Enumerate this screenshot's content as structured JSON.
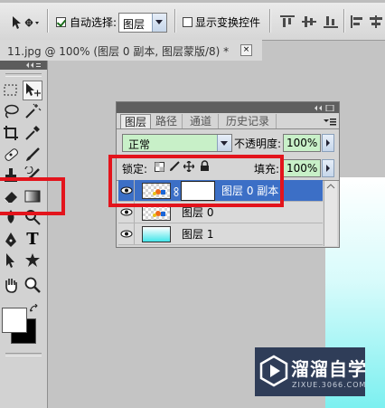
{
  "options_bar": {
    "auto_select_label": "自动选择:",
    "auto_select_checked": true,
    "auto_select_target": "图层",
    "show_transform_label": "显示变换控件",
    "show_transform_checked": false,
    "move_tool_icon": "move-tool-icon",
    "align_icons": [
      "align-top-icon",
      "align-vcenter-icon",
      "align-bottom-icon",
      "align-left-icon",
      "align-hcenter-icon",
      "align-right-icon"
    ]
  },
  "document_tab": {
    "title": "11.jpg @ 100% (图层 0 副本, 图层蒙版/8) *",
    "close_label": "×"
  },
  "tools_panel": {
    "tools": [
      "marquee-tool-icon",
      "move-tool-icon",
      "lasso-tool-icon",
      "magic-wand-tool-icon",
      "crop-tool-icon",
      "eyedropper-tool-icon",
      "healing-brush-tool-icon",
      "brush-tool-icon",
      "clone-stamp-tool-icon",
      "history-brush-tool-icon",
      "eraser-tool-icon",
      "gradient-tool-icon",
      "blur-tool-icon",
      "dodge-tool-icon",
      "pen-tool-icon",
      "type-tool-icon",
      "path-selection-tool-icon",
      "custom-shape-tool-icon",
      "hand-tool-icon",
      "zoom-tool-icon"
    ],
    "type_tool_glyph": "T",
    "foreground_color": "#ffffff",
    "background_color": "#000000"
  },
  "layers_panel": {
    "tabs": [
      "图层",
      "路径",
      "通道",
      "历史记录"
    ],
    "active_tab": "图层",
    "blend_mode": "正常",
    "opacity_label": "不透明度:",
    "opacity_value": "100%",
    "lock_label": "锁定:",
    "fill_label": "填充:",
    "fill_value": "100%",
    "layers": [
      {
        "name": "图层 0 副本",
        "selected": true,
        "has_mask": true
      },
      {
        "name": "图层 0",
        "selected": false,
        "has_mask": false
      },
      {
        "name": "图层 1",
        "selected": false,
        "has_mask": false
      }
    ]
  },
  "highlight_color": "#e3141c",
  "watermark": {
    "brand": "溜溜自学",
    "url": "ZIXUE.3066.COM",
    "play_icon": "play-icon"
  }
}
